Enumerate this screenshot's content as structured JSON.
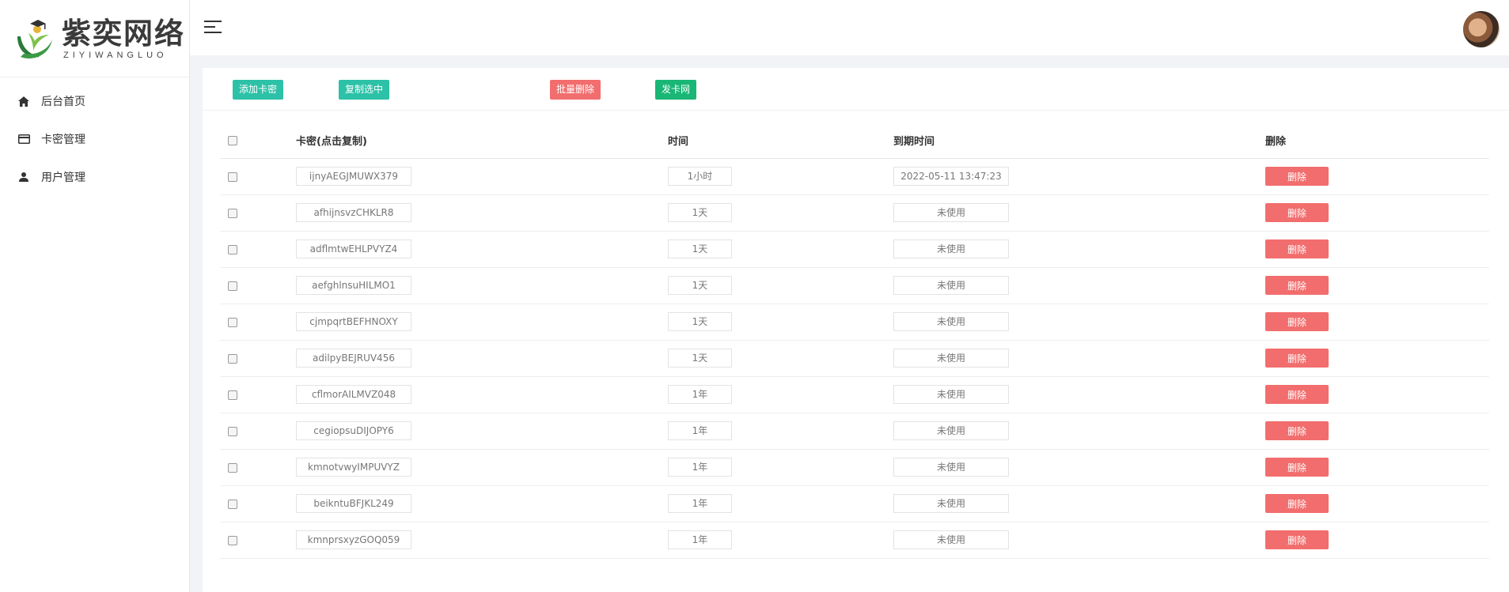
{
  "brand": {
    "name_cn": "紫奕网络",
    "name_en": "ZIYIWANGLUO"
  },
  "sidebar": {
    "items": [
      {
        "label": "后台首页",
        "icon": "home-icon"
      },
      {
        "label": "卡密管理",
        "icon": "card-icon"
      },
      {
        "label": "用户管理",
        "icon": "user-icon"
      }
    ]
  },
  "toolbar": {
    "add_label": "添加卡密",
    "copy_label": "复制选中",
    "batch_delete_label": "批量删除",
    "faka_label": "发卡网"
  },
  "table": {
    "headers": [
      "卡密(点击复制)",
      "时间",
      "到期时间",
      "删除"
    ],
    "delete_label": "删除",
    "rows": [
      {
        "key": "ijnyAEGJMUWX379",
        "duration": "1小时",
        "expiry": "2022-05-11 13:47:23"
      },
      {
        "key": "afhijnsvzCHKLR8",
        "duration": "1天",
        "expiry": "未使用"
      },
      {
        "key": "adflmtwEHLPVYZ4",
        "duration": "1天",
        "expiry": "未使用"
      },
      {
        "key": "aefghlnsuHILMO1",
        "duration": "1天",
        "expiry": "未使用"
      },
      {
        "key": "cjmpqrtBEFHNOXY",
        "duration": "1天",
        "expiry": "未使用"
      },
      {
        "key": "adilpyBEJRUV456",
        "duration": "1天",
        "expiry": "未使用"
      },
      {
        "key": "cflmorAILMVZ048",
        "duration": "1年",
        "expiry": "未使用"
      },
      {
        "key": "cegiopsuDIJOPY6",
        "duration": "1年",
        "expiry": "未使用"
      },
      {
        "key": "kmnotvwyIMPUVYZ",
        "duration": "1年",
        "expiry": "未使用"
      },
      {
        "key": "beikntuBFJKL249",
        "duration": "1年",
        "expiry": "未使用"
      },
      {
        "key": "kmnprsxyzGOQ059",
        "duration": "1年",
        "expiry": "未使用"
      }
    ]
  },
  "colors": {
    "teal": "#2dc1a7",
    "red": "#f26d6d",
    "green": "#19b676"
  }
}
